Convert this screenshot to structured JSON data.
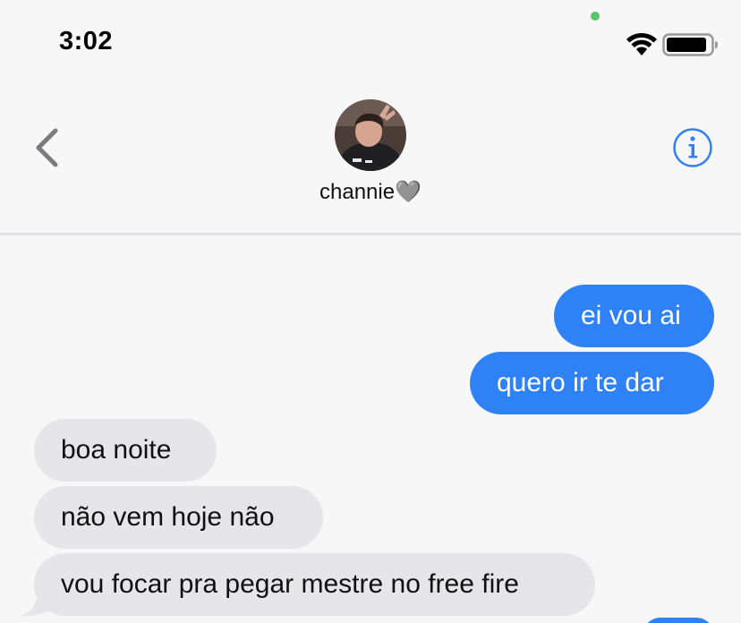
{
  "status_bar": {
    "time": "3:02",
    "wifi_icon": "wifi-icon",
    "battery_icon": "battery-icon",
    "mic_indicator_color": "#5cc46b"
  },
  "header": {
    "back_icon": "chevron-left-icon",
    "contact_name": "channie",
    "contact_emoji": "🩶",
    "info_icon": "info-circle-icon"
  },
  "colors": {
    "sent_bubble": "#2e82f6",
    "received_bubble": "#e5e5ea",
    "accent": "#2e82f6",
    "background": "#f7f7f8"
  },
  "messages": [
    {
      "direction": "sent",
      "text": "ei vou ai"
    },
    {
      "direction": "sent",
      "text": "quero ir te dar"
    },
    {
      "direction": "received",
      "text": "boa noite"
    },
    {
      "direction": "received",
      "text": "não vem hoje não"
    },
    {
      "direction": "received",
      "text": "vou focar pra pegar mestre no free fire"
    }
  ]
}
